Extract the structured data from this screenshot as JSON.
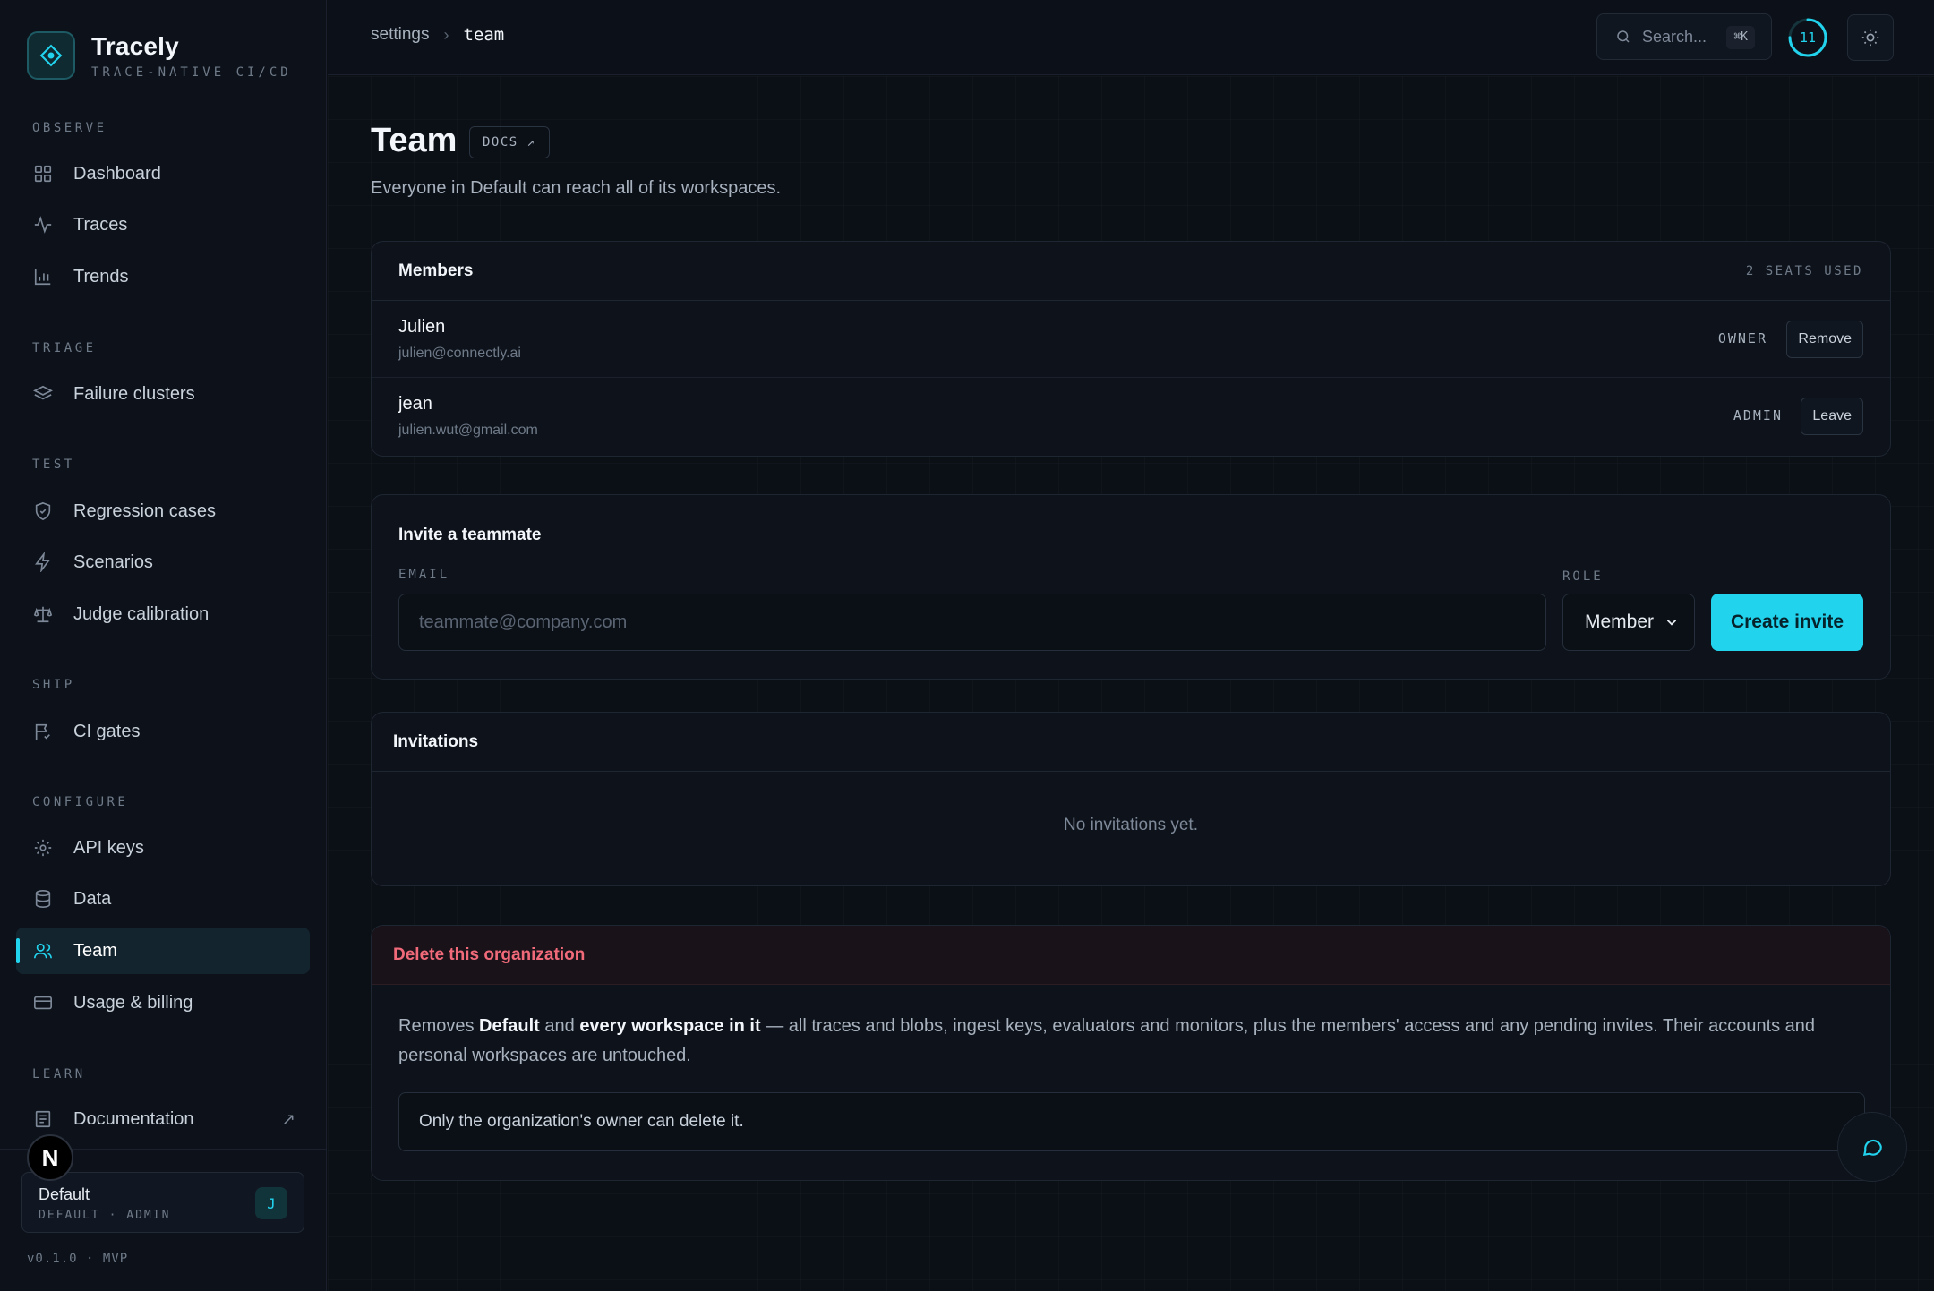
{
  "app": {
    "name": "Tracely",
    "tagline": "TRACE-NATIVE CI/CD",
    "version": "v0.1.0 · MVP"
  },
  "colors": {
    "accent": "#22d3ee",
    "danger": "#f06a7a",
    "background": "#0b0f16"
  },
  "sidebar": {
    "sections": [
      {
        "label": "OBSERVE",
        "items": [
          {
            "label": "Dashboard",
            "icon": "grid-icon"
          },
          {
            "label": "Traces",
            "icon": "pulse-icon"
          },
          {
            "label": "Trends",
            "icon": "bar-chart-icon"
          }
        ]
      },
      {
        "label": "TRIAGE",
        "items": [
          {
            "label": "Failure clusters",
            "icon": "layers-icon"
          }
        ]
      },
      {
        "label": "TEST",
        "items": [
          {
            "label": "Regression cases",
            "icon": "shield-check-icon"
          },
          {
            "label": "Scenarios",
            "icon": "lightning-icon"
          },
          {
            "label": "Judge calibration",
            "icon": "scale-icon"
          }
        ]
      },
      {
        "label": "SHIP",
        "items": [
          {
            "label": "CI gates",
            "icon": "flag-check-icon"
          }
        ]
      },
      {
        "label": "CONFIGURE",
        "items": [
          {
            "label": "API keys",
            "icon": "gear-icon"
          },
          {
            "label": "Data",
            "icon": "database-icon"
          },
          {
            "label": "Team",
            "icon": "users-icon",
            "active": true
          },
          {
            "label": "Usage & billing",
            "icon": "credit-card-icon"
          }
        ]
      },
      {
        "label": "LEARN",
        "items": [
          {
            "label": "Documentation",
            "icon": "book-icon",
            "external": true
          }
        ]
      }
    ],
    "badge_letter": "N",
    "org": {
      "name": "Default",
      "subtitle": "DEFAULT · ADMIN",
      "avatar": "J"
    }
  },
  "topbar": {
    "breadcrumb": [
      "settings",
      "team"
    ],
    "search_placeholder": "Search...",
    "search_shortcut": "⌘K",
    "ring_count": "11",
    "ring_level": 0.75
  },
  "page": {
    "title": "Team",
    "docs_label": "DOCS ↗",
    "subtitle": "Everyone in Default can reach all of its workspaces."
  },
  "members": {
    "title": "Members",
    "seats": "2 SEATS USED",
    "list": [
      {
        "name": "Julien",
        "email": "julien@connectly.ai",
        "role": "OWNER",
        "action": "Remove"
      },
      {
        "name": "jean",
        "email": "julien.wut@gmail.com",
        "role": "ADMIN",
        "action": "Leave"
      }
    ]
  },
  "invite": {
    "title": "Invite a teammate",
    "email_label": "EMAIL",
    "email_placeholder": "teammate@company.com",
    "email_value": "",
    "role_label": "ROLE",
    "role_value": "Member",
    "submit": "Create invite"
  },
  "invitations": {
    "title": "Invitations",
    "empty": "No invitations yet."
  },
  "danger": {
    "title": "Delete this organization",
    "text_parts": [
      {
        "t": "Removes ",
        "b": false
      },
      {
        "t": "Default",
        "b": true
      },
      {
        "t": " and ",
        "b": false
      },
      {
        "t": "every workspace in it",
        "b": true
      },
      {
        "t": " — all traces and blobs, ingest keys, evaluators and monitors, plus the members' access and any pending invites. Their accounts and personal workspaces are untouched.",
        "b": false
      }
    ],
    "notice": "Only the organization's owner can delete it."
  }
}
